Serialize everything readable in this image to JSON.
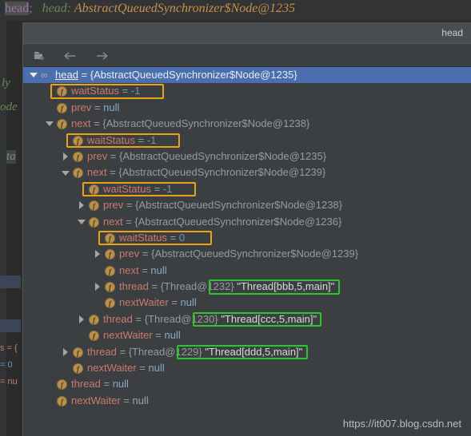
{
  "editor": {
    "top_line": {
      "highlighted_token": "head",
      "semicolon": ";",
      "hint_label": "head:",
      "hint_value": "AbstractQueuedSynchronizer$Node@1235"
    },
    "visible_fragments": [
      {
        "text": "ly",
        "color": "#6A8759"
      },
      {
        "text": "ode",
        "color": "#6A8759"
      },
      {
        "text": "ta",
        "color": "#9876AA"
      }
    ],
    "bottom_fragments": [
      {
        "text": "s = {",
        "color": "#cc7a6f"
      },
      {
        "text": "= 0",
        "color": "#6897bb"
      },
      {
        "text": "= nu",
        "color": "#cc7a6f"
      }
    ]
  },
  "popup": {
    "title": "head",
    "toolbar": [
      {
        "name": "jump-to-source-icon",
        "label": "Jump to source"
      },
      {
        "name": "back-arrow-icon",
        "label": "Back"
      },
      {
        "name": "forward-arrow-icon",
        "label": "Forward"
      }
    ]
  },
  "tree": {
    "rows": [
      {
        "indent": 0,
        "arrow": "down",
        "icon": "infinity",
        "name": "head",
        "eq": " = ",
        "value": "{AbstractQueuedSynchronizer$Node@1235}",
        "vtype": "obj",
        "selected": true,
        "highlight": null
      },
      {
        "indent": 1,
        "arrow": "none",
        "icon": "field",
        "name": "waitStatus",
        "eq": " = ",
        "value": "-1",
        "vtype": "num",
        "selected": false,
        "highlight": "orange"
      },
      {
        "indent": 1,
        "arrow": "none",
        "icon": "field",
        "name": "prev",
        "eq": " = ",
        "value": "null",
        "vtype": "null",
        "selected": false,
        "highlight": null
      },
      {
        "indent": 1,
        "arrow": "down",
        "icon": "field",
        "name": "next",
        "eq": " = ",
        "value": "{AbstractQueuedSynchronizer$Node@1238}",
        "vtype": "obj",
        "selected": false,
        "highlight": null
      },
      {
        "indent": 2,
        "arrow": "none",
        "icon": "field",
        "name": "waitStatus",
        "eq": " = ",
        "value": "-1",
        "vtype": "num",
        "selected": false,
        "highlight": "orange"
      },
      {
        "indent": 2,
        "arrow": "right",
        "icon": "field",
        "name": "prev",
        "eq": " = ",
        "value": "{AbstractQueuedSynchronizer$Node@1235}",
        "vtype": "obj",
        "selected": false,
        "highlight": null
      },
      {
        "indent": 2,
        "arrow": "down",
        "icon": "field",
        "name": "next",
        "eq": " = ",
        "value": "{AbstractQueuedSynchronizer$Node@1239}",
        "vtype": "obj",
        "selected": false,
        "highlight": null
      },
      {
        "indent": 3,
        "arrow": "none",
        "icon": "field",
        "name": "waitStatus",
        "eq": " = ",
        "value": "-1",
        "vtype": "num",
        "selected": false,
        "highlight": "orange"
      },
      {
        "indent": 3,
        "arrow": "right",
        "icon": "field",
        "name": "prev",
        "eq": " = ",
        "value": "{AbstractQueuedSynchronizer$Node@1238}",
        "vtype": "obj",
        "selected": false,
        "highlight": null
      },
      {
        "indent": 3,
        "arrow": "down",
        "icon": "field",
        "name": "next",
        "eq": " = ",
        "value": "{AbstractQueuedSynchronizer$Node@1236}",
        "vtype": "obj",
        "selected": false,
        "highlight": null
      },
      {
        "indent": 4,
        "arrow": "none",
        "icon": "field",
        "name": "waitStatus",
        "eq": " = ",
        "value": "0",
        "vtype": "num",
        "selected": false,
        "highlight": "orange"
      },
      {
        "indent": 4,
        "arrow": "right",
        "icon": "field",
        "name": "prev",
        "eq": " = ",
        "value": "{AbstractQueuedSynchronizer$Node@1239}",
        "vtype": "obj",
        "selected": false,
        "highlight": null
      },
      {
        "indent": 4,
        "arrow": "none",
        "icon": "field",
        "name": "next",
        "eq": " = ",
        "value": "null",
        "vtype": "null",
        "selected": false,
        "highlight": null
      },
      {
        "indent": 4,
        "arrow": "right",
        "icon": "field",
        "name": "thread",
        "eq": " = ",
        "value": "{Thread@1232}",
        "vtype": "obj",
        "selected": false,
        "highlight": null,
        "strval": " \"Thread[bbb,5,main]\"",
        "strhl": "green"
      },
      {
        "indent": 4,
        "arrow": "none",
        "icon": "field",
        "name": "nextWaiter",
        "eq": " = ",
        "value": "null",
        "vtype": "null",
        "selected": false,
        "highlight": null
      },
      {
        "indent": 3,
        "arrow": "right",
        "icon": "field",
        "name": "thread",
        "eq": " = ",
        "value": "{Thread@1230}",
        "vtype": "obj",
        "selected": false,
        "highlight": null,
        "strval": " \"Thread[ccc,5,main]\"",
        "strhl": "green"
      },
      {
        "indent": 3,
        "arrow": "none",
        "icon": "field",
        "name": "nextWaiter",
        "eq": " = ",
        "value": "null",
        "vtype": "null",
        "selected": false,
        "highlight": null
      },
      {
        "indent": 2,
        "arrow": "right",
        "icon": "field",
        "name": "thread",
        "eq": " = ",
        "value": "{Thread@1229}",
        "vtype": "obj",
        "selected": false,
        "highlight": null,
        "strval": " \"Thread[ddd,5,main]\"",
        "strhl": "green"
      },
      {
        "indent": 2,
        "arrow": "none",
        "icon": "field",
        "name": "nextWaiter",
        "eq": " = ",
        "value": "null",
        "vtype": "null",
        "selected": false,
        "highlight": null
      },
      {
        "indent": 1,
        "arrow": "none",
        "icon": "field",
        "name": "thread",
        "eq": " = ",
        "value": "null",
        "vtype": "null",
        "selected": false,
        "highlight": null
      },
      {
        "indent": 1,
        "arrow": "none",
        "icon": "field",
        "name": "nextWaiter",
        "eq": " = ",
        "value": "null",
        "vtype": "null",
        "selected": false,
        "highlight": null
      }
    ]
  },
  "watermark": {
    "text": "https://it007.blog.csdn.net"
  },
  "colors": {
    "selection_blue": "#4b6eaf",
    "highlight_orange": "#e8a317",
    "highlight_green": "#2fc42f",
    "field_name": "#cc7a6f",
    "object_value": "#9a9a9a",
    "null_value": "#8ba8c4",
    "number_value": "#6897bb",
    "popup_bg": "#3c3f41"
  }
}
